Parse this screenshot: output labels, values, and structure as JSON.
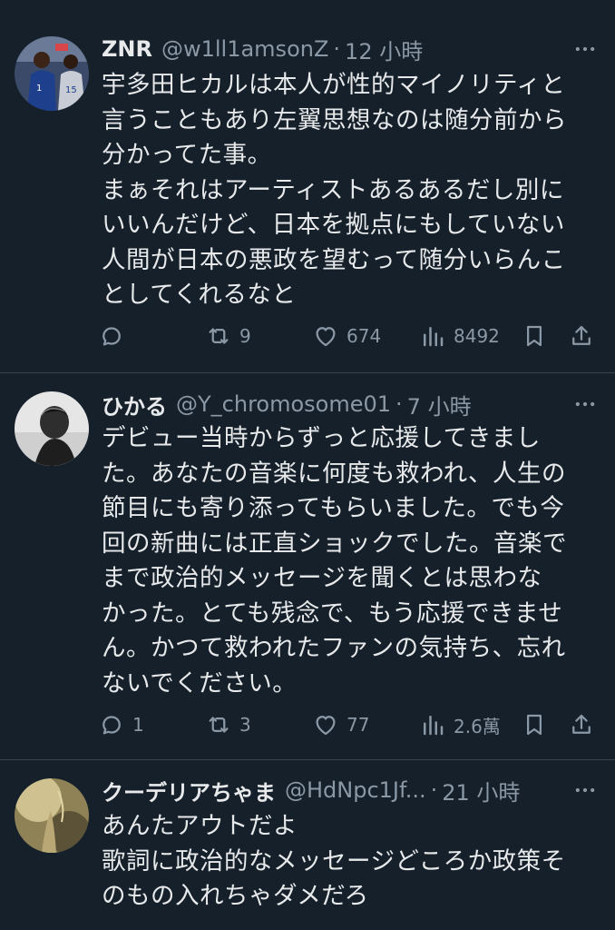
{
  "tweets": [
    {
      "name": "ZNR",
      "handle": "@w1ll1amsonZ",
      "time": "12 小時",
      "text": "宇多田ヒカルは本人が性的マイノリティと\n言うこともあり左翼思想なのは随分前から\n分かってた事。\nまぁそれはアーティストあるあるだし別に\nいいんだけど、日本を拠点にもしていない\n人間が日本の悪政を望むって随分いらんこ\nとしてくれるなと",
      "replies": "",
      "retweets": "9",
      "likes": "674",
      "views": "8492"
    },
    {
      "name": "ひかる",
      "handle": "@Y_chromosome01",
      "time": "7 小時",
      "text": "デビュー当時からずっと応援してきまし\nた。あなたの音楽に何度も救われ、人生の\n節目にも寄り添ってもらいました。でも今\n回の新曲には正直ショックでした。音楽で\nまで政治的メッセージを聞くとは思わな\nかった。とても残念で、もう応援できませ\nん。かつて救われたファンの気持ち、忘れ\nないでください。",
      "replies": "1",
      "retweets": "3",
      "likes": "77",
      "views": "2.6萬"
    },
    {
      "name": "クーデリアちゃま",
      "handle": "@HdNpc1Jf...",
      "time": "21 小時",
      "text": "あんたアウトだよ\n歌詞に政治的なメッセージどころか政策そ\nのもの入れちゃダメだろ"
    }
  ],
  "colors": {
    "background": "#15202b",
    "text": "#e7e9ea",
    "secondary": "#8b98a5",
    "divider": "#38444d"
  },
  "icons": [
    "more-icon",
    "reply-icon",
    "retweet-icon",
    "like-icon",
    "views-icon",
    "bookmark-icon",
    "share-icon"
  ]
}
